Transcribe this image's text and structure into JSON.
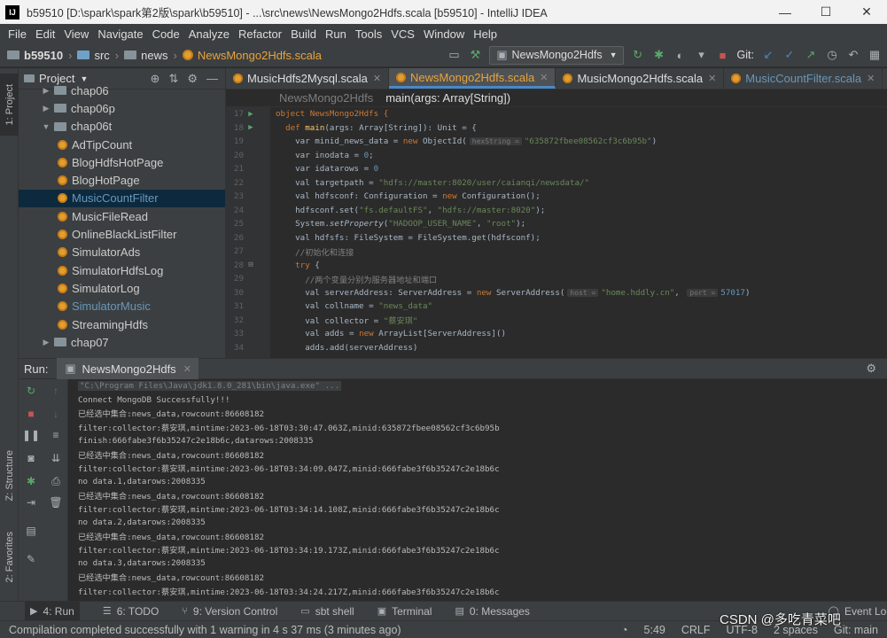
{
  "window": {
    "title": "b59510 [D:\\spark\\spark第2版\\spark\\b59510] - ...\\src\\news\\NewsMongo2Hdfs.scala [b59510] - IntelliJ IDEA",
    "app_icon": "IJ",
    "minimize": "—",
    "maximize": "☐"
  },
  "menu": [
    "File",
    "Edit",
    "View",
    "Navigate",
    "Code",
    "Analyze",
    "Refactor",
    "Build",
    "Run",
    "Tools",
    "VCS",
    "Window",
    "Help"
  ],
  "breadcrumb": {
    "project": "b59510",
    "folder1": "src",
    "folder2": "news",
    "file": "NewsMongo2Hdfs.scala"
  },
  "toolbar": {
    "run_config": "NewsMongo2Hdfs",
    "git_label": "Git:"
  },
  "left_stripe": {
    "project_tab": "1: Project",
    "structure_tab": "Z: Structure",
    "favorites_tab": "2: Favorites"
  },
  "project_panel": {
    "title": "Project",
    "items": [
      {
        "label": "chap06",
        "kind": "folder",
        "indent": 1,
        "open": false
      },
      {
        "label": "chap06p",
        "kind": "folder",
        "indent": 1,
        "open": false
      },
      {
        "label": "chap06t",
        "kind": "folder",
        "indent": 1,
        "open": true
      },
      {
        "label": "AdTipCount",
        "kind": "object",
        "indent": 2
      },
      {
        "label": "BlogHdfsHotPage",
        "kind": "object",
        "indent": 2
      },
      {
        "label": "BlogHotPage",
        "kind": "object",
        "indent": 2
      },
      {
        "label": "MusicCountFilter",
        "kind": "object",
        "indent": 2,
        "selected": true
      },
      {
        "label": "MusicFileRead",
        "kind": "object",
        "indent": 2
      },
      {
        "label": "OnlineBlackListFilter",
        "kind": "object",
        "indent": 2
      },
      {
        "label": "SimulatorAds",
        "kind": "object",
        "indent": 2
      },
      {
        "label": "SimulatorHdfsLog",
        "kind": "object",
        "indent": 2
      },
      {
        "label": "SimulatorLog",
        "kind": "object",
        "indent": 2
      },
      {
        "label": "SimulatorMusic",
        "kind": "object",
        "indent": 2,
        "blue": true
      },
      {
        "label": "StreamingHdfs",
        "kind": "object",
        "indent": 2
      },
      {
        "label": "chap07",
        "kind": "folder",
        "indent": 1,
        "open": false
      }
    ]
  },
  "editor": {
    "tabs": [
      {
        "label": "MusicHdfs2Mysql.scala",
        "active": false
      },
      {
        "label": "NewsMongo2Hdfs.scala",
        "active": true
      },
      {
        "label": "MusicMongo2Hdfs.scala",
        "active": false
      },
      {
        "label": "MusicCountFilter.scala",
        "active": false
      }
    ],
    "breadcrumb_object": "NewsMongo2Hdfs",
    "breadcrumb_method": "main(args: Array[String])",
    "line_numbers": [
      "17",
      "18",
      "19",
      "20",
      "21",
      "22",
      "23",
      "24",
      "25",
      "26",
      "27",
      "28",
      "29",
      "30",
      "31",
      "32",
      "33",
      "34"
    ],
    "code": {
      "l17": "object NewsMongo2Hdfs {",
      "l18_a": "def ",
      "l18_b": "main",
      "l18_c": "(args: Array[String]): Unit = {",
      "l19_a": "var minid_news_data = ",
      "l19_b": "new ",
      "l19_c": "ObjectId(",
      "l19_hint": "hexString =",
      "l19_str": "\"635872fbee08562cf3c6b95b\"",
      "l19_end": ")",
      "l20_a": "var inodata = ",
      "l20_num": "0",
      "l20_end": ";",
      "l21_a": "var idatarows = ",
      "l21_num": "0",
      "l22_a": "val targetpath = ",
      "l22_str": "\"hdfs://master:8020/user/caianqi/newsdata/\"",
      "l23_a": "val hdfsconf: Configuration = ",
      "l23_b": "new ",
      "l23_c": "Configuration();",
      "l24_a": "hdfsconf.set(",
      "l24_s1": "\"fs.defaultFS\"",
      "l24_m": ", ",
      "l24_s2": "\"hdfs://master:8020\"",
      "l24_end": ");",
      "l25_a": "System.",
      "l25_fn": "setProperty",
      "l25_b": "(",
      "l25_s1": "\"HADOOP_USER_NAME\"",
      "l25_m": ", ",
      "l25_s2": "\"root\"",
      "l25_end": ");",
      "l26_a": "val hdfsfs: FileSystem = FileSystem.",
      "l26_fn": "get",
      "l26_end": "(hdfsconf);",
      "l27": "//初始化和连接",
      "l28_a": "try ",
      "l28_b": "{",
      "l29": "//两个变量分别为服务器地址和端口",
      "l30_a": "val serverAddress: ServerAddress = ",
      "l30_b": "new ",
      "l30_c": "ServerAddress(",
      "l30_h1": "host =",
      "l30_s": "\"home.hddly.cn\"",
      "l30_m": ", ",
      "l30_h2": "port =",
      "l30_num": "57017",
      "l30_end": ")",
      "l31_a": "val collname = ",
      "l31_s": "\"news_data\"",
      "l32_a": "val collector = ",
      "l32_s": "\"蔡安琪\"",
      "l33_a": "val adds = ",
      "l33_b": "new ",
      "l33_c": "ArrayList[ServerAddress]()",
      "l34": "adds.add(serverAddress)"
    }
  },
  "run_panel": {
    "label": "Run:",
    "tab": "NewsMongo2Hdfs",
    "output": [
      "\"C:\\Program Files\\Java\\jdk1.8.0_281\\bin\\java.exe\" ...",
      "Connect MongoDB Successfully!!!",
      "已经选中集合:news_data,rowcount:86608182",
      "filter:collector:蔡安琪,mintime:2023-06-18T03:30:47.063Z,minid:635872fbee08562cf3c6b95b",
      "finish:666fabe3f6b35247c2e18b6c,datarows:2008335",
      "已经选中集合:news_data,rowcount:86608182",
      "filter:collector:蔡安琪,mintime:2023-06-18T03:34:09.047Z,minid:666fabe3f6b35247c2e18b6c",
      "no data.1,datarows:2008335",
      "已经选中集合:news_data,rowcount:86608182",
      "filter:collector:蔡安琪,mintime:2023-06-18T03:34:14.108Z,minid:666fabe3f6b35247c2e18b6c",
      "no data.2,datarows:2008335",
      "已经选中集合:news_data,rowcount:86608182",
      "filter:collector:蔡安琪,mintime:2023-06-18T03:34:19.173Z,minid:666fabe3f6b35247c2e18b6c",
      "no data.3,datarows:2008335",
      "已经选中集合:news_data,rowcount:86608182",
      "filter:collector:蔡安琪,mintime:2023-06-18T03:34:24.217Z,minid:666fabe3f6b35247c2e18b6c"
    ]
  },
  "bottom_tabs": {
    "run": "4: Run",
    "todo": "6: TODO",
    "vcs": "9: Version Control",
    "sbt": "sbt shell",
    "terminal": "Terminal",
    "messages": "0: Messages",
    "event_log": "Event Log"
  },
  "status": {
    "message": "Compilation completed successfully with 1 warning in 4 s 37 ms (3 minutes ago)",
    "position": "5:49",
    "line_sep": "CRLF",
    "encoding": "UTF-8",
    "indent": "2 spaces",
    "git": "Git: main"
  },
  "watermark": "CSDN @多吃青菜吧"
}
